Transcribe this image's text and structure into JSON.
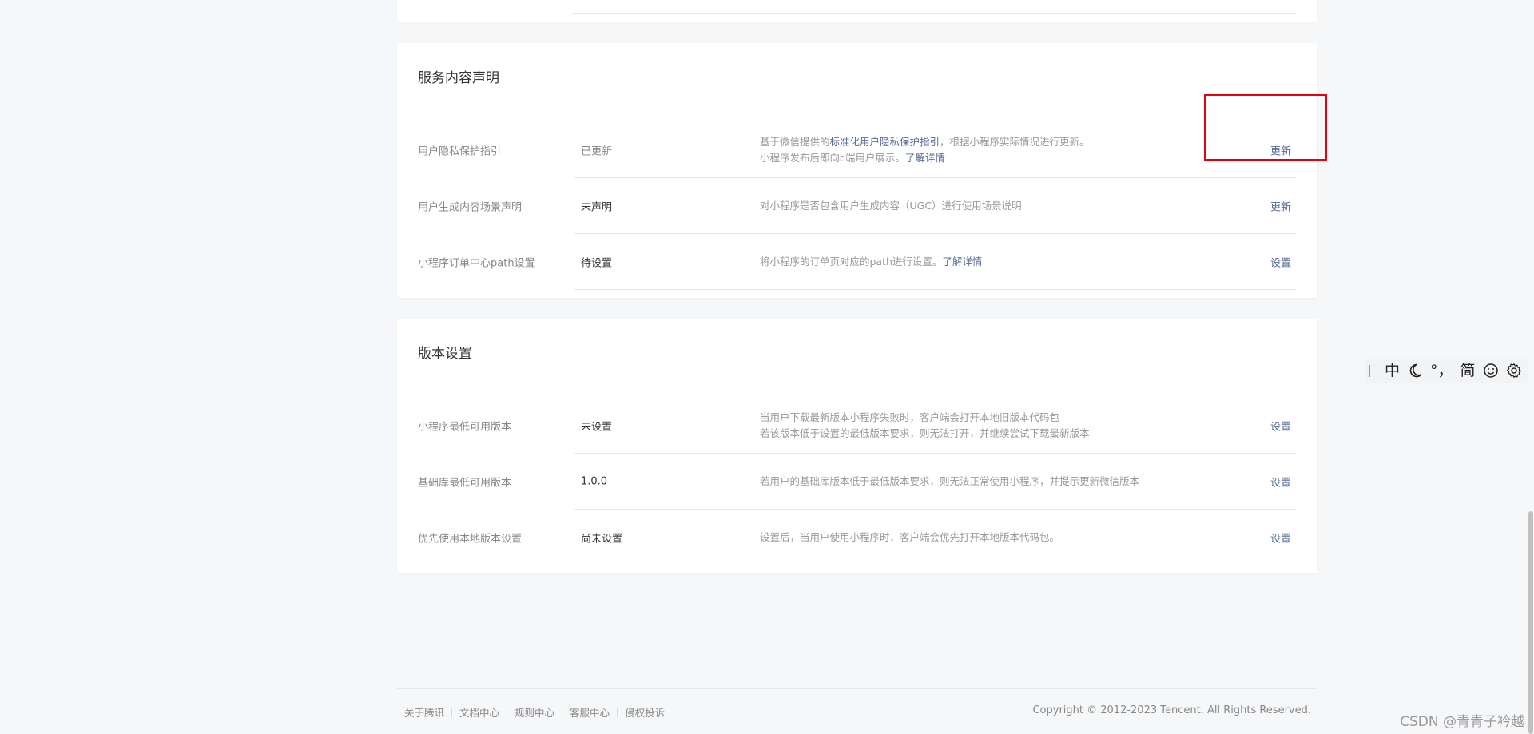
{
  "service_section": {
    "title": "服务内容声明",
    "rows": [
      {
        "label": "用户隐私保护指引",
        "status": "已更新",
        "desc_line1_prefix": "基于微信提供的",
        "desc_line1_link": "标准化用户隐私保护指引",
        "desc_line1_suffix": "，根据小程序实际情况进行更新。",
        "desc_line2_prefix": "小程序发布后即向c端用户展示。",
        "desc_line2_link": "了解详情",
        "action": "更新"
      },
      {
        "label": "用户生成内容场景声明",
        "status": "未声明",
        "desc": "对小程序是否包含用户生成内容（UGC）进行使用场景说明",
        "action": "更新"
      },
      {
        "label": "小程序订单中心path设置",
        "status": "待设置",
        "desc_prefix": "将小程序的订单页对应的path进行设置。",
        "desc_link": "了解详情",
        "action": "设置"
      }
    ]
  },
  "version_section": {
    "title": "版本设置",
    "rows": [
      {
        "label": "小程序最低可用版本",
        "status": "未设置",
        "desc_line1": "当用户下载最新版本小程序失败时，客户端会打开本地旧版本代码包",
        "desc_line2": "若该版本低于设置的最低版本要求，则无法打开，并继续尝试下载最新版本",
        "action": "设置"
      },
      {
        "label": "基础库最低可用版本",
        "status": "1.0.0",
        "desc": "若用户的基础库版本低于最低版本要求，则无法正常使用小程序，并提示更新微信版本",
        "action": "设置"
      },
      {
        "label": "优先使用本地版本设置",
        "status": "尚未设置",
        "desc": "设置后，当用户使用小程序时，客户端会优先打开本地版本代码包。",
        "action": "设置"
      }
    ]
  },
  "ime_toolbar": {
    "mode": "中",
    "punct": "°，",
    "charset": "简",
    "icons": [
      "moon-icon",
      "smiley-icon",
      "gear-icon"
    ]
  },
  "footer": {
    "links": [
      "关于腾讯",
      "文档中心",
      "规则中心",
      "客服中心",
      "侵权投诉"
    ],
    "copyright": "Copyright © 2012-2023 Tencent. All Rights Reserved."
  },
  "watermark": "CSDN @青青子衿越",
  "colors": {
    "link": "#576b95",
    "highlight": "#e60012",
    "background": "#f6f7f9",
    "card": "#ffffff"
  }
}
